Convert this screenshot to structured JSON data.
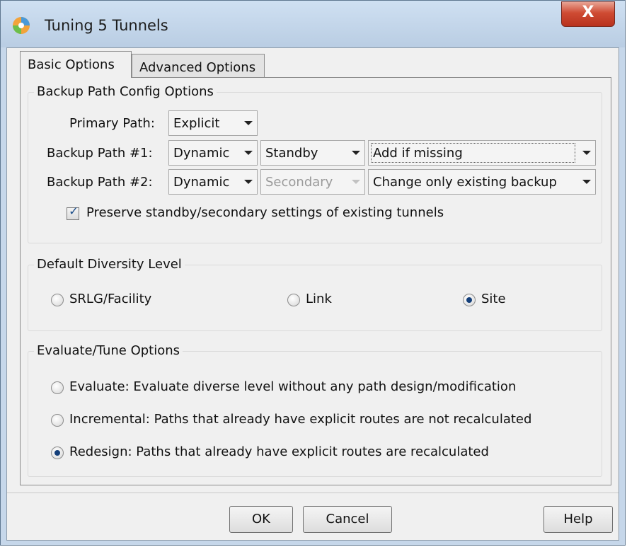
{
  "window": {
    "title": "Tuning 5 Tunnels",
    "close_label": "X"
  },
  "tabs": [
    {
      "label": "Basic Options",
      "active": true
    },
    {
      "label": "Advanced Options",
      "active": false
    }
  ],
  "backup_path": {
    "title": "Backup Path Config Options",
    "primary": {
      "label": "Primary Path:",
      "mode": "Explicit"
    },
    "backup1": {
      "label": "Backup Path #1:",
      "mode": "Dynamic",
      "type": "Standby",
      "action": "Add if missing"
    },
    "backup2": {
      "label": "Backup Path #2:",
      "mode": "Dynamic",
      "type": "Secondary",
      "action": "Change only existing backup"
    },
    "preserve": {
      "label": "Preserve standby/secondary settings of existing tunnels",
      "checked": true
    }
  },
  "diversity": {
    "title": "Default Diversity Level",
    "options": [
      {
        "label": "SRLG/Facility",
        "checked": false
      },
      {
        "label": "Link",
        "checked": false
      },
      {
        "label": "Site",
        "checked": true
      }
    ]
  },
  "evaluate": {
    "title": "Evaluate/Tune Options",
    "options": [
      {
        "label": "Evaluate: Evaluate diverse level without any path design/modification",
        "checked": false
      },
      {
        "label": "Incremental: Paths that already have explicit routes are not recalculated",
        "checked": false
      },
      {
        "label": "Redesign: Paths that already have explicit routes are recalculated",
        "checked": true
      }
    ]
  },
  "buttons": {
    "ok": "OK",
    "cancel": "Cancel",
    "help": "Help"
  },
  "colors": {
    "window_frame": "#c6d7ea",
    "close_button": "#cf4b33",
    "radio_dot": "#143f7a"
  }
}
